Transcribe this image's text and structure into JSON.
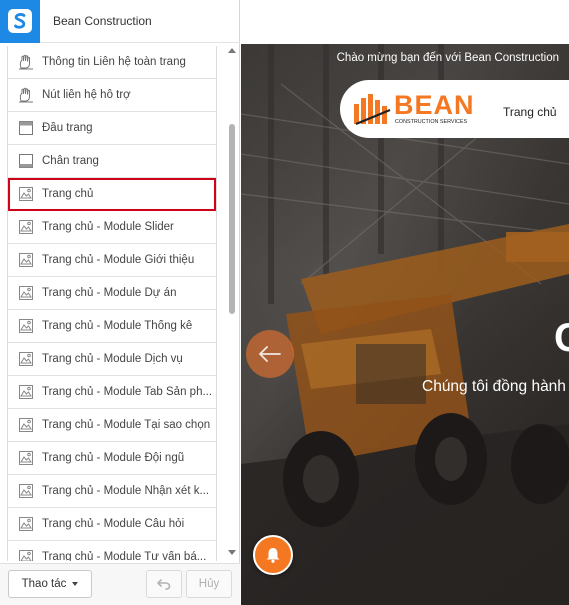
{
  "header": {
    "logo_icon": "s-logo-icon",
    "site_name": "Bean Construction"
  },
  "sections": [
    {
      "label": "Thông tin Liên hệ toàn trang",
      "icon": "hand-icon"
    },
    {
      "label": "Nút liên hệ hỗ trợ",
      "icon": "hand-icon"
    },
    {
      "label": "Đầu trang",
      "icon": "header-layout-icon"
    },
    {
      "label": "Chân trang",
      "icon": "footer-layout-icon"
    },
    {
      "label": "Trang chủ",
      "icon": "page-icon",
      "selected": true
    },
    {
      "label": "Trang chủ - Module Slider",
      "icon": "page-icon"
    },
    {
      "label": "Trang chủ - Module Giới thiệu",
      "icon": "page-icon"
    },
    {
      "label": "Trang chủ - Module Dự án",
      "icon": "page-icon"
    },
    {
      "label": "Trang chủ - Module Thống kê",
      "icon": "page-icon"
    },
    {
      "label": "Trang chủ - Module Dịch vụ",
      "icon": "page-icon"
    },
    {
      "label": "Trang chủ - Module Tab Sản ph...",
      "icon": "page-icon"
    },
    {
      "label": "Trang chủ - Module Tại sao chọn",
      "icon": "page-icon"
    },
    {
      "label": "Trang chủ - Module Đội ngũ",
      "icon": "page-icon"
    },
    {
      "label": "Trang chủ - Module Nhận xét k...",
      "icon": "page-icon"
    },
    {
      "label": "Trang chủ - Module Câu hỏi",
      "icon": "page-icon"
    },
    {
      "label": "Trang chủ - Module Tư vấn bá...",
      "icon": "page-icon"
    }
  ],
  "footer": {
    "action_label": "Thao tác",
    "undo_icon": "undo-icon",
    "cancel_label": "Hủy"
  },
  "preview": {
    "welcome_text": "Chào mừng bạn đến với Bean Construction",
    "brand_name": "BEAN",
    "brand_tagline": "CONSTRUCTION SERVICES",
    "nav_home": "Trang chủ",
    "hero_title_partial": "C",
    "hero_subtitle": "Chúng tôi đồng hành",
    "colors": {
      "accent": "#f47721",
      "selection_outline": "#d0021b",
      "logo_blue": "#1e88e5"
    }
  }
}
